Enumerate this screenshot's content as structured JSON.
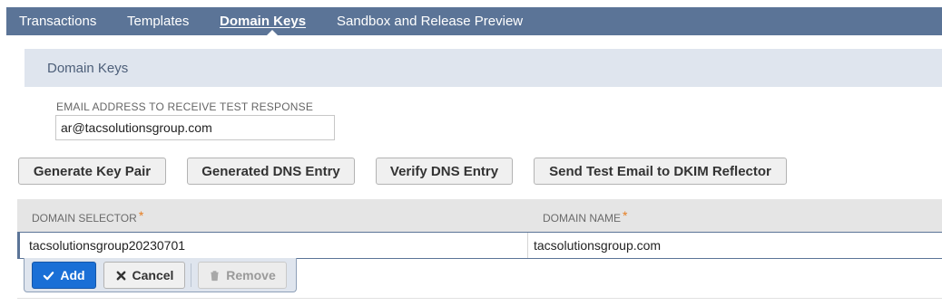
{
  "nav": {
    "tabs": [
      {
        "label": "Transactions"
      },
      {
        "label": "Templates"
      },
      {
        "label": "Domain Keys",
        "active": true
      },
      {
        "label": "Sandbox and Release Preview"
      }
    ]
  },
  "section": {
    "title": "Domain Keys"
  },
  "email": {
    "label": "EMAIL ADDRESS TO RECEIVE TEST RESPONSE",
    "value": "ar@tacsolutionsgroup.com"
  },
  "actions": {
    "generate_key_pair": "Generate Key Pair",
    "generated_dns_entry": "Generated DNS Entry",
    "verify_dns_entry": "Verify DNS Entry",
    "send_test_email": "Send Test Email to DKIM Reflector"
  },
  "table": {
    "columns": [
      {
        "label": "DOMAIN SELECTOR",
        "required": true
      },
      {
        "label": "DOMAIN NAME",
        "required": true
      }
    ],
    "required_marker": "*",
    "rows": [
      {
        "domain_selector": "tacsolutionsgroup20230701",
        "domain_name": "tacsolutionsgroup.com"
      }
    ]
  },
  "row_actions": {
    "add": "Add",
    "cancel": "Cancel",
    "remove": "Remove",
    "remove_disabled": true
  },
  "colors": {
    "nav_bg": "#5b7497",
    "section_bg": "#dfe5ee",
    "accent_blue": "#1a6fd6",
    "required": "#e67e22"
  },
  "icons": {
    "add": "check-icon",
    "cancel": "x-icon",
    "remove": "trash-icon"
  }
}
